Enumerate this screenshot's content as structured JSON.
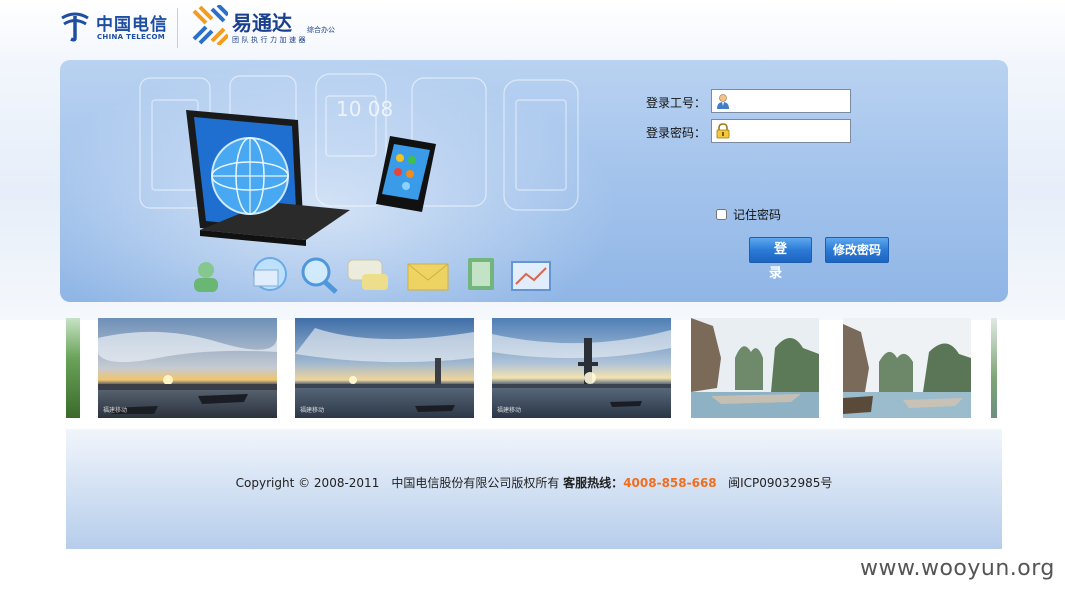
{
  "header": {
    "telecom_cn": "中国电信",
    "telecom_en": "CHINA TELECOM",
    "product_name": "易通达",
    "product_sub": "综合办公",
    "product_slogan": "团队执行力加速器"
  },
  "login": {
    "username_label": "登录工号：",
    "password_label": "登录密码：",
    "username_value": "",
    "password_value": "",
    "remember_label": "记住密码",
    "remember_checked": false,
    "login_button": "登　录",
    "change_password_button": "修改密码"
  },
  "banner": {
    "phone_clock": "10 08"
  },
  "photos": [
    {
      "scene": "sunset-harbor",
      "mark": "福建移动"
    },
    {
      "scene": "sunset-tower",
      "mark": "福建移动"
    },
    {
      "scene": "sunset-bridge",
      "mark": "福建移动"
    },
    {
      "scene": "karst-river",
      "mark": ""
    },
    {
      "scene": "karst-raft",
      "mark": ""
    }
  ],
  "footer": {
    "copyright": "Copyright © 2008-2011　中国电信股份有限公司版权所有",
    "hotline_label": "客服热线：",
    "hotline_number": "4008-858-668",
    "icp": "闽ICP09032985号"
  },
  "watermark": "www.wooyun.org",
  "colors": {
    "brand_blue": "#1d4ea1",
    "banner_blue": "#a3c3ec",
    "button_blue": "#2b7bd6",
    "hotline_orange": "#f06e1e"
  }
}
